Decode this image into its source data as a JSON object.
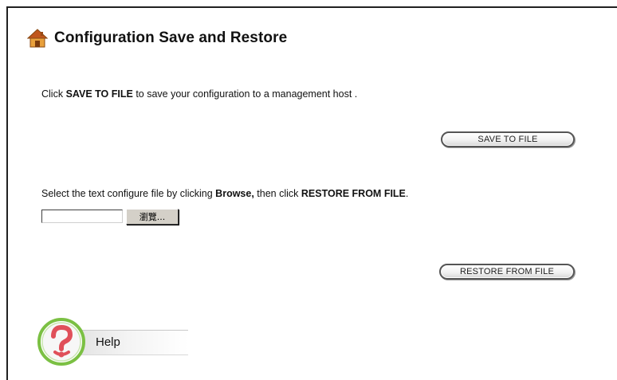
{
  "page": {
    "title": "Configuration Save and Restore",
    "title_icon": "home-icon"
  },
  "save_section": {
    "instruction_prefix": "Click ",
    "instruction_bold": "SAVE TO FILE",
    "instruction_suffix": " to save your configuration to a management host .",
    "button_label": "SAVE TO FILE"
  },
  "restore_section": {
    "instruction_prefix": "Select the text configure file by clicking ",
    "instruction_bold_1": "Browse,",
    "instruction_middle": " then click ",
    "instruction_bold_2": "RESTORE FROM FILE",
    "instruction_suffix": ".",
    "file_input_value": "",
    "browse_label": "瀏覽...",
    "button_label": "RESTORE FROM FILE"
  },
  "help": {
    "label": "Help",
    "icon": "help-question-icon"
  },
  "colors": {
    "help_ring": "#7bc043",
    "help_mark": "#e0505a",
    "home_roof": "#d2691e",
    "frame": "#202020"
  }
}
